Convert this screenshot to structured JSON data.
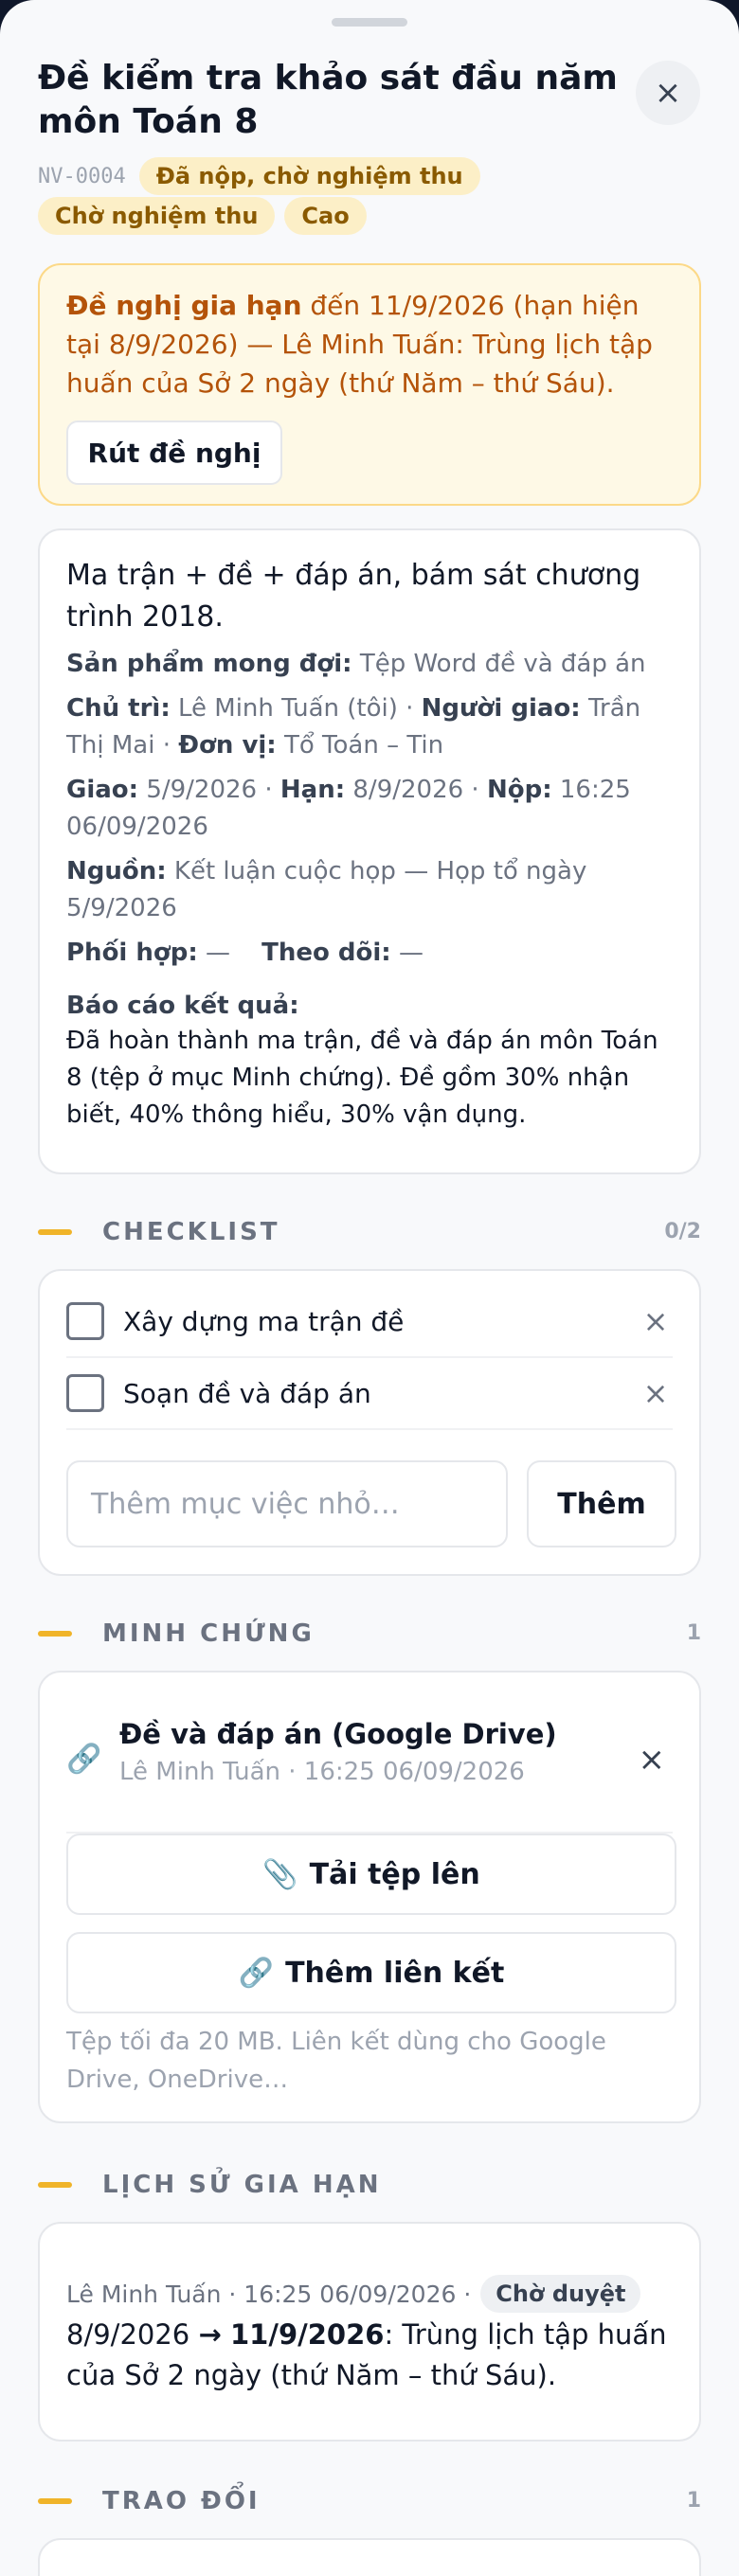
{
  "sheet": {
    "title": "Đề kiểm tra khảo sát đầu năm môn Toán 8",
    "close_icon": "×",
    "code": "NV-0004",
    "badges": [
      "Đã nộp, chờ nghiệm thu",
      "Chờ nghiệm thu",
      "Cao"
    ]
  },
  "extension_request": {
    "label": "Đề nghị gia hạn",
    "text": "đến 11/9/2026 (hạn hiện tại 8/9/2026) — Lê Minh Tuấn: Trùng lịch tập huấn của Sở 2 ngày (thứ Năm – thứ Sáu).",
    "withdraw_label": "Rút đề nghị"
  },
  "details": {
    "description": "Ma trận + đề + đáp án, bám sát chương trình 2018.",
    "expected_label": "Sản phẩm mong đợi:",
    "expected_value": "Tệp Word đề và đáp án",
    "owner_label": "Chủ trì:",
    "owner_value": "Lê Minh Tuấn (tôi)",
    "assigner_label": "Người giao:",
    "assigner_value": "Trần Thị Mai",
    "unit_label": "Đơn vị:",
    "unit_value": "Tổ Toán – Tin",
    "assigned_label": "Giao:",
    "assigned_value": "5/9/2026",
    "due_label": "Hạn:",
    "due_value": "8/9/2026",
    "submitted_label": "Nộp:",
    "submitted_value": "16:25 06/09/2026",
    "source_label": "Nguồn:",
    "source_value": "Kết luận cuộc họp — Họp tổ ngày 5/9/2026",
    "coop_label": "Phối hợp:",
    "coop_value": "—",
    "follow_label": "Theo dõi:",
    "follow_value": "—",
    "report_label": "Báo cáo kết quả:",
    "report_text": "Đã hoàn thành ma trận, đề và đáp án môn Toán 8 (tệp ở mục Minh chứng). Đề gồm 30% nhận biết, 40% thông hiểu, 30% vận dụng."
  },
  "checklist": {
    "title": "CHECKLIST",
    "count": "0/2",
    "items": [
      {
        "label": "Xây dựng ma trận đề",
        "done": false
      },
      {
        "label": "Soạn đề và đáp án",
        "done": false
      }
    ],
    "remove_icon": "×",
    "input_placeholder": "Thêm mục việc nhỏ…",
    "add_label": "Thêm"
  },
  "evidence": {
    "title": "MINH CHỨNG",
    "count": "1",
    "items": [
      {
        "icon": "link-icon",
        "title": "Đề và đáp án (Google Drive)",
        "meta": "Lê Minh Tuấn · 16:25 06/09/2026"
      }
    ],
    "remove_icon": "×",
    "upload_label": "Tải tệp lên",
    "link_label": "Thêm liên kết",
    "note": "Tệp tối đa 20 MB. Liên kết dùng cho Google Drive, OneDrive…"
  },
  "extension_history": {
    "title": "LỊCH SỬ GIA HẠN",
    "entries": [
      {
        "meta": "Lê Minh Tuấn · 16:25 06/09/2026 ·",
        "status": "Chờ duyệt",
        "from": "8/9/2026",
        "arrow": "→",
        "to": "11/9/2026",
        "reason": ": Trùng lịch tập huấn của Sở 2 ngày (thứ Năm – thứ Sáu)."
      }
    ]
  },
  "discussion": {
    "title": "TRAO ĐỔI",
    "count": "1"
  },
  "colors": {
    "accent": "#f0b429",
    "warning_text": "#b45309",
    "badge_bg": "#fcefc7",
    "badge_text": "#8a5a00"
  }
}
